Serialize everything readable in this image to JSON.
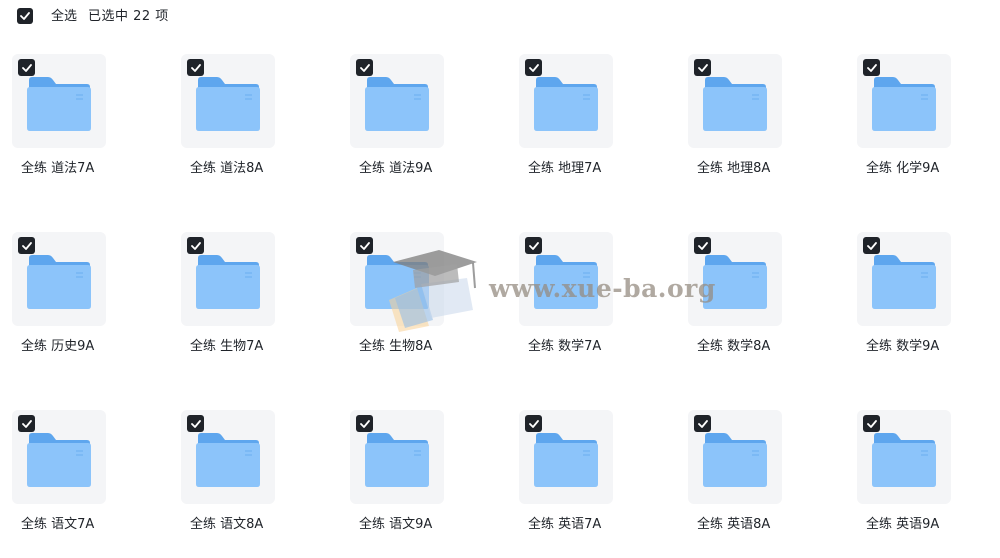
{
  "toolbar": {
    "select_all_label": "全选",
    "selected_text": "已选中 22 项"
  },
  "folders": [
    {
      "name": "全练 道法7A",
      "checked": true
    },
    {
      "name": "全练 道法8A",
      "checked": true
    },
    {
      "name": "全练 道法9A",
      "checked": true
    },
    {
      "name": "全练 地理7A",
      "checked": true
    },
    {
      "name": "全练 地理8A",
      "checked": true
    },
    {
      "name": "全练 化学9A",
      "checked": true
    },
    {
      "name": "全练 历史9A",
      "checked": true
    },
    {
      "name": "全练 生物7A",
      "checked": true
    },
    {
      "name": "全练 生物8A",
      "checked": true
    },
    {
      "name": "全练 数学7A",
      "checked": true
    },
    {
      "name": "全练 数学8A",
      "checked": true
    },
    {
      "name": "全练 数学9A",
      "checked": true
    },
    {
      "name": "全练 语文7A",
      "checked": true
    },
    {
      "name": "全练 语文8A",
      "checked": true
    },
    {
      "name": "全练 语文9A",
      "checked": true
    },
    {
      "name": "全练 英语7A",
      "checked": true
    },
    {
      "name": "全练 英语8A",
      "checked": true
    },
    {
      "name": "全练 英语9A",
      "checked": true
    }
  ],
  "watermark": {
    "text": "www.xue-ba.org",
    "icon": "graduation-cap-book-icon"
  },
  "colors": {
    "checkbox": "#1f2329",
    "folder_back": "#5ea6ee",
    "folder_front": "#8cc4fa",
    "tile_bg": "#f4f5f7"
  },
  "icons": {
    "checkbox": "checkmark-icon",
    "folder": "folder-icon"
  }
}
